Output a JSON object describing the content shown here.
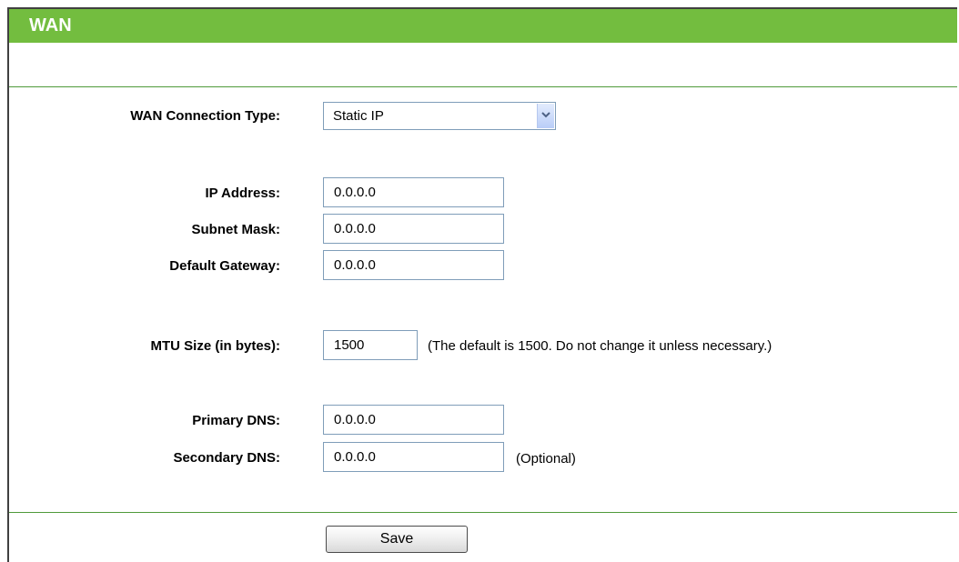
{
  "header": {
    "title": "WAN"
  },
  "form": {
    "connection_type": {
      "label": "WAN Connection Type:",
      "selected": "Static IP"
    },
    "ip_address": {
      "label": "IP Address:",
      "value": "0.0.0.0"
    },
    "subnet_mask": {
      "label": "Subnet Mask:",
      "value": "0.0.0.0"
    },
    "default_gateway": {
      "label": "Default Gateway:",
      "value": "0.0.0.0"
    },
    "mtu": {
      "label": "MTU Size (in bytes):",
      "value": "1500",
      "note": "(The default is 1500. Do not change it unless necessary.)"
    },
    "primary_dns": {
      "label": "Primary DNS:",
      "value": "0.0.0.0"
    },
    "secondary_dns": {
      "label": "Secondary DNS:",
      "value": "0.0.0.0",
      "note": "(Optional)"
    }
  },
  "actions": {
    "save_label": "Save"
  },
  "colors": {
    "header_bg": "#73bd3f",
    "divider": "#4f9a3a"
  }
}
